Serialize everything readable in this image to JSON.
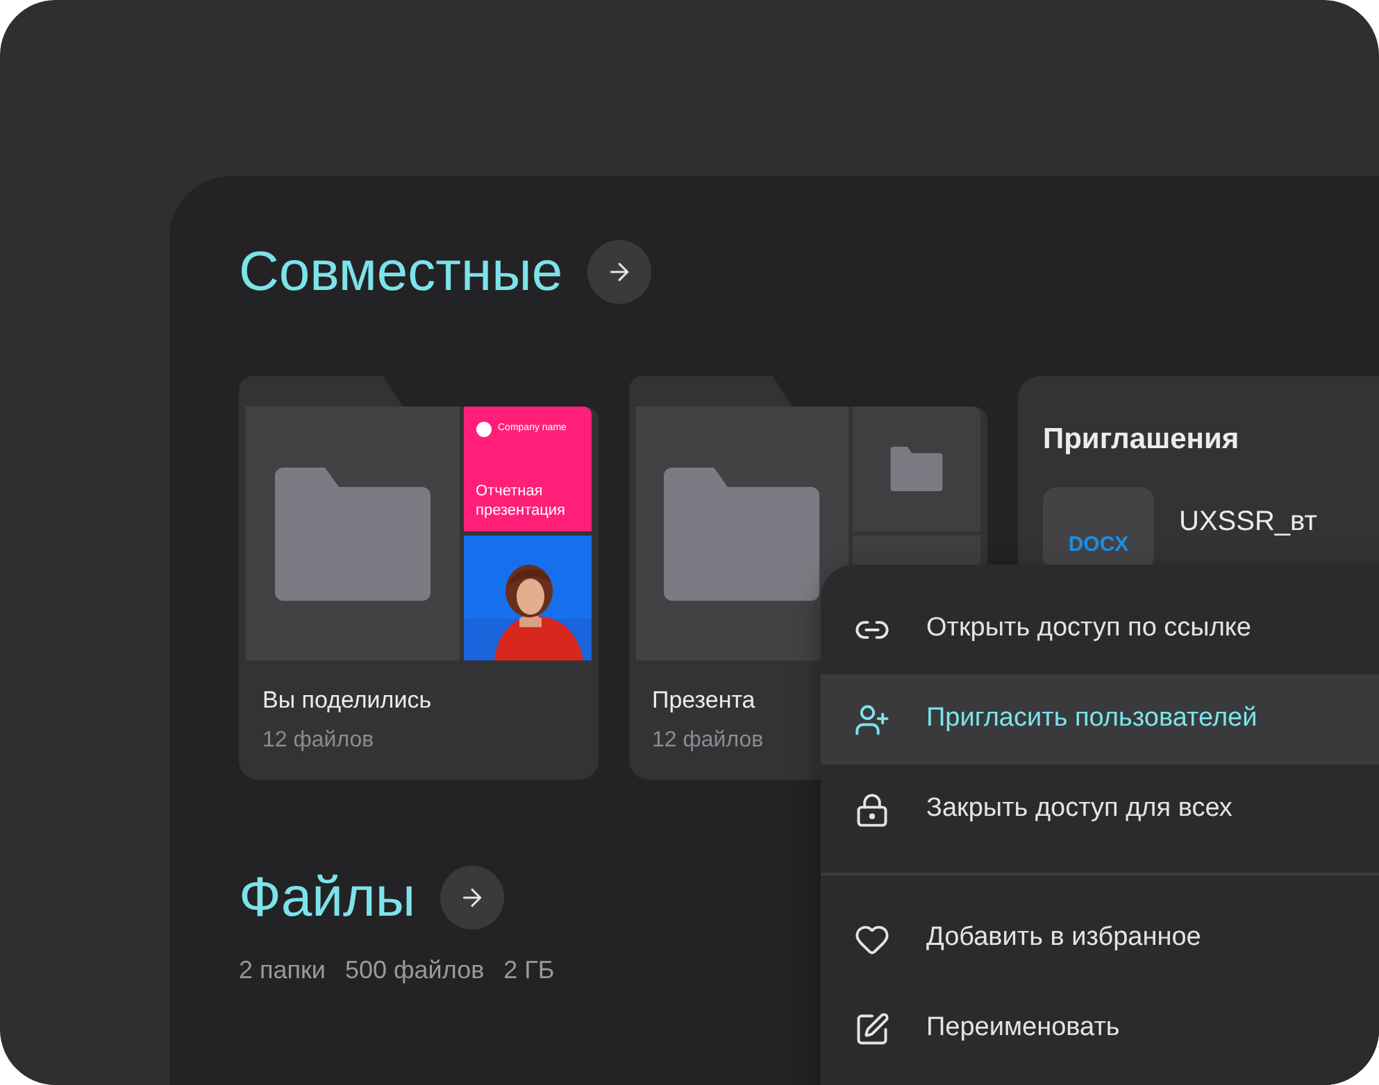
{
  "shared": {
    "title": "Совместные",
    "folders": [
      {
        "name": "Вы поделились",
        "count": "12 файлов",
        "preview": {
          "kind": "presentation",
          "company": "Company name",
          "slide_title": "Отчетная презентация"
        }
      },
      {
        "name": "Презента",
        "count": "12 файлов",
        "preview": {
          "kind": "folders"
        }
      }
    ],
    "invitations": {
      "title": "Приглашения",
      "file": {
        "type": "DOCX",
        "name": "UXSSR_вт"
      }
    }
  },
  "files": {
    "title": "Файлы",
    "stats": [
      "2 папки",
      "500 файлов",
      "2 ГБ"
    ]
  },
  "context_menu": [
    {
      "label": "Открыть доступ по ссылке",
      "selected": false,
      "separator_after": false
    },
    {
      "label": "Пригласить пользователей",
      "selected": true,
      "separator_after": false
    },
    {
      "label": "Закрыть доступ для всех",
      "selected": false,
      "separator_after": true
    },
    {
      "label": "Добавить в избранное",
      "selected": false,
      "separator_after": false
    },
    {
      "label": "Переименовать",
      "selected": false,
      "separator_after": false
    }
  ]
}
